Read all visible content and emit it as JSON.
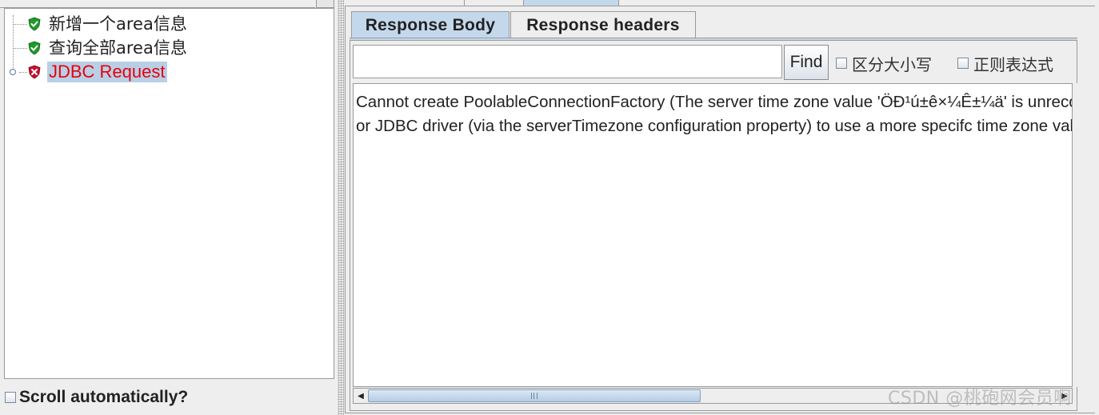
{
  "tree": {
    "items": [
      {
        "label": "新增一个area信息",
        "status": "success",
        "icon": "green-shield-check-icon"
      },
      {
        "label": "查询全部area信息",
        "status": "success",
        "icon": "green-shield-check-icon"
      },
      {
        "label": "JDBC Request",
        "status": "error",
        "icon": "red-shield-x-icon",
        "selected": true
      }
    ]
  },
  "scroll_automatically": {
    "label": "Scroll automatically?",
    "checked": false
  },
  "tabs": [
    {
      "label": "Response Body",
      "active": true
    },
    {
      "label": "Response headers",
      "active": false
    }
  ],
  "search": {
    "value": "",
    "placeholder": "",
    "find_label": "Find",
    "case_sensitive_label": "区分大小写",
    "regex_label": "正则表达式"
  },
  "response": {
    "lines": [
      "Cannot create PoolableConnectionFactory (The server time zone value 'ÖÐ¹ú±ê×¼Ê±¼ä' is unrecognized or represents more than one time zone. You must configure either the server",
      "or JDBC driver (via the serverTimezone configuration property) to use a more specifc time zone value if you want to utilize time zone support.)"
    ]
  },
  "watermark": "CSDN @桃砲网会员啊",
  "colors": {
    "selection": "#b8cfe5",
    "error_text": "#e8000b",
    "tab_active": "#c4d8ec",
    "success_icon": "#1f9a2a",
    "error_icon": "#c8102e"
  }
}
